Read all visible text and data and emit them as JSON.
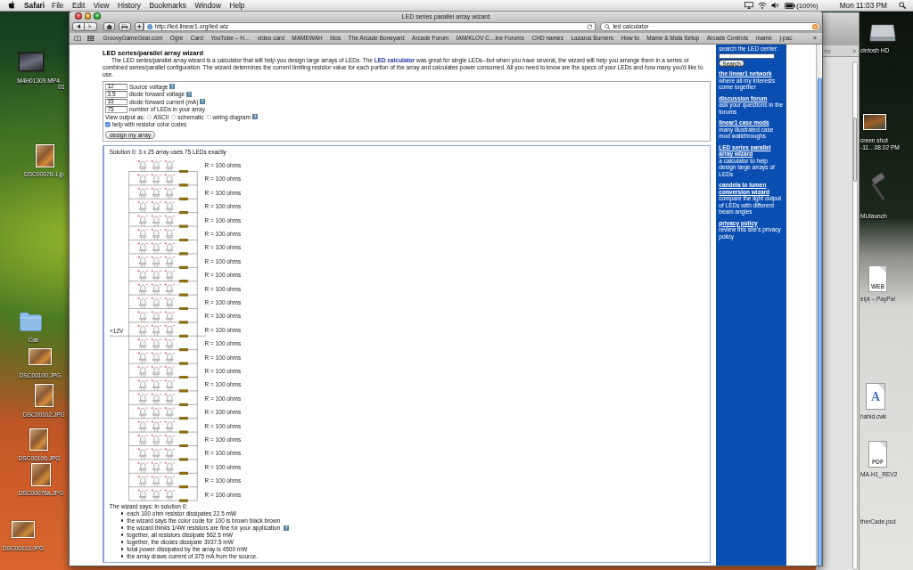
{
  "menu_bar": {
    "app": "Safari",
    "menus": [
      "File",
      "Edit",
      "View",
      "History",
      "Bookmarks",
      "Window",
      "Help"
    ],
    "battery_text": "(100%)",
    "clock": "Mon 11:03 PM"
  },
  "desktop_left": [
    {
      "kind": "video",
      "lines": [
        "M4H01309.MP4"
      ]
    },
    {
      "kind": "text",
      "lines": [
        "01"
      ]
    },
    {
      "kind": "photo",
      "lines": [
        "DSC00076-1.jp"
      ]
    },
    {
      "kind": "folder",
      "lines": [
        "Cab"
      ]
    },
    {
      "kind": "photo",
      "lines": [
        "DSC00100.JPG"
      ]
    },
    {
      "kind": "photo",
      "lines": [
        "DSC00102.JPG"
      ]
    },
    {
      "kind": "photo",
      "lines": [
        "DSC00106.JPG"
      ]
    },
    {
      "kind": "photo",
      "lines": [
        "DSC00076a.JPG"
      ]
    },
    {
      "kind": "photo",
      "lines": [
        "DSC00113.JPG"
      ]
    }
  ],
  "desktop_right": [
    {
      "kind": "drive",
      "lines": [
        "cintosh HD"
      ]
    },
    {
      "kind": "screenshot",
      "lines": [
        "creen shot",
        "-11…08.02 PM"
      ]
    },
    {
      "kind": "app",
      "lines": [
        "MUlaunch"
      ]
    },
    {
      "kind": "document",
      "badge": "WEB",
      "lines": [
        "eipt – PayPal"
      ]
    },
    {
      "kind": "letter-document",
      "badge": "A",
      "lines": [
        "hahid.cwk"
      ]
    },
    {
      "kind": "document",
      "badge": "PDF",
      "lines": [
        "MA-H1_REV2"
      ]
    },
    {
      "kind": "text",
      "lines": [
        "therCade.psd"
      ]
    }
  ],
  "background_window": {
    "label": "nc",
    "more": "»"
  },
  "browser": {
    "title": "LED series parallel array wizard",
    "back_disabled": false,
    "forward_disabled": true,
    "url": "http://led.linear1.org/led.wiz",
    "search": "led calculator",
    "bookmarks": [
      "GroovyGameGear.com",
      "Ogre",
      "Card",
      "YouTube – H…",
      "video card",
      "MAMEWAH",
      "bios",
      "The Arcade Boneyard",
      "Arcade Forum",
      "IAM/KLOV C…ine Forums",
      "CHD names",
      "Lazarus Burners",
      "How to",
      "Mame & Mala Setup",
      "Arcade Controls",
      "mame",
      "j-pac"
    ],
    "more": "»"
  },
  "page": {
    "heading": "LED series/parallel array wizard",
    "intro": {
      "before": "The LED series/parallel array wizard is a calculator that will help you design large arrays of LEDs. The ",
      "link": "LED calculator",
      "after": " was great for single LEDs--but when you have several, the wizard will help you arrange them in a series or combined series/parallel configuration. The wizard determines the current limiting resistor value for each portion of the array and calculates power consumed. All you need to know are the specs of your LEDs and how many you'd like to use."
    },
    "form": {
      "fields": [
        {
          "value": "12",
          "label": "Source voltage",
          "help": true
        },
        {
          "value": "3.5",
          "label": "diode forward voltage",
          "help": true
        },
        {
          "value": "15",
          "label": "diode forward current (mA)",
          "help": true
        },
        {
          "value": "75",
          "label": "number of LEDs in your array",
          "help": false
        }
      ],
      "output_label": "View output as:",
      "output_options": [
        {
          "label": "ASCII",
          "selected": false
        },
        {
          "label": "schematic",
          "selected": false
        },
        {
          "label": "wiring diagram",
          "selected": false
        }
      ],
      "output_help": true,
      "color_codes": {
        "label": "help with resistor color codes",
        "checked": true
      },
      "submit": "design my array"
    },
    "result": {
      "heading": "Solution 0: 3 x 25 array uses 75 LEDs exactly",
      "supply": "+12V",
      "rows": [
        {
          "parts": [
            {
              "kind": "led"
            },
            {
              "kind": "led"
            },
            {
              "kind": "led"
            },
            {
              "kind": "resistor"
            }
          ],
          "label": "R = 100 ohms"
        },
        {
          "parts": [
            {
              "kind": "led"
            },
            {
              "kind": "led"
            },
            {
              "kind": "led"
            },
            {
              "kind": "resistor"
            }
          ],
          "label": "R = 100 ohms"
        },
        {
          "parts": [
            {
              "kind": "led"
            },
            {
              "kind": "led"
            },
            {
              "kind": "led"
            },
            {
              "kind": "resistor"
            }
          ],
          "label": "R = 100 ohms"
        },
        {
          "parts": [
            {
              "kind": "led"
            },
            {
              "kind": "led"
            },
            {
              "kind": "led"
            },
            {
              "kind": "resistor"
            }
          ],
          "label": "R = 100 ohms"
        },
        {
          "parts": [
            {
              "kind": "led"
            },
            {
              "kind": "led"
            },
            {
              "kind": "led"
            },
            {
              "kind": "resistor"
            }
          ],
          "label": "R = 100 ohms"
        },
        {
          "parts": [
            {
              "kind": "led"
            },
            {
              "kind": "led"
            },
            {
              "kind": "led"
            },
            {
              "kind": "resistor"
            }
          ],
          "label": "R = 100 ohms"
        },
        {
          "parts": [
            {
              "kind": "led"
            },
            {
              "kind": "led"
            },
            {
              "kind": "led"
            },
            {
              "kind": "resistor"
            }
          ],
          "label": "R = 100 ohms"
        },
        {
          "parts": [
            {
              "kind": "led"
            },
            {
              "kind": "led"
            },
            {
              "kind": "led"
            },
            {
              "kind": "resistor"
            }
          ],
          "label": "R = 100 ohms"
        },
        {
          "parts": [
            {
              "kind": "led"
            },
            {
              "kind": "led"
            },
            {
              "kind": "led"
            },
            {
              "kind": "resistor"
            }
          ],
          "label": "R = 100 ohms"
        },
        {
          "parts": [
            {
              "kind": "led"
            },
            {
              "kind": "led"
            },
            {
              "kind": "led"
            },
            {
              "kind": "resistor"
            }
          ],
          "label": "R = 100 ohms"
        },
        {
          "parts": [
            {
              "kind": "led"
            },
            {
              "kind": "led"
            },
            {
              "kind": "led"
            },
            {
              "kind": "resistor"
            }
          ],
          "label": "R = 100 ohms"
        },
        {
          "parts": [
            {
              "kind": "led"
            },
            {
              "kind": "led"
            },
            {
              "kind": "led"
            },
            {
              "kind": "resistor"
            }
          ],
          "label": "R = 100 ohms"
        },
        {
          "parts": [
            {
              "kind": "led"
            },
            {
              "kind": "led"
            },
            {
              "kind": "led"
            },
            {
              "kind": "resistor"
            }
          ],
          "label": "R = 100 ohms"
        },
        {
          "parts": [
            {
              "kind": "led"
            },
            {
              "kind": "led"
            },
            {
              "kind": "led"
            },
            {
              "kind": "resistor"
            }
          ],
          "label": "R = 100 ohms"
        },
        {
          "parts": [
            {
              "kind": "led"
            },
            {
              "kind": "led"
            },
            {
              "kind": "led"
            },
            {
              "kind": "resistor"
            }
          ],
          "label": "R = 100 ohms"
        },
        {
          "parts": [
            {
              "kind": "led"
            },
            {
              "kind": "led"
            },
            {
              "kind": "led"
            },
            {
              "kind": "resistor"
            }
          ],
          "label": "R = 100 ohms"
        },
        {
          "parts": [
            {
              "kind": "led"
            },
            {
              "kind": "led"
            },
            {
              "kind": "led"
            },
            {
              "kind": "resistor"
            }
          ],
          "label": "R = 100 ohms"
        },
        {
          "parts": [
            {
              "kind": "led"
            },
            {
              "kind": "led"
            },
            {
              "kind": "led"
            },
            {
              "kind": "resistor"
            }
          ],
          "label": "R = 100 ohms"
        },
        {
          "parts": [
            {
              "kind": "led"
            },
            {
              "kind": "led"
            },
            {
              "kind": "led"
            },
            {
              "kind": "resistor"
            }
          ],
          "label": "R = 100 ohms"
        },
        {
          "parts": [
            {
              "kind": "led"
            },
            {
              "kind": "led"
            },
            {
              "kind": "led"
            },
            {
              "kind": "resistor"
            }
          ],
          "label": "R = 100 ohms"
        },
        {
          "parts": [
            {
              "kind": "led"
            },
            {
              "kind": "led"
            },
            {
              "kind": "led"
            },
            {
              "kind": "resistor"
            }
          ],
          "label": "R = 100 ohms"
        },
        {
          "parts": [
            {
              "kind": "led"
            },
            {
              "kind": "led"
            },
            {
              "kind": "led"
            },
            {
              "kind": "resistor"
            }
          ],
          "label": "R = 100 ohms"
        },
        {
          "parts": [
            {
              "kind": "led"
            },
            {
              "kind": "led"
            },
            {
              "kind": "led"
            },
            {
              "kind": "resistor"
            }
          ],
          "label": "R = 100 ohms"
        },
        {
          "parts": [
            {
              "kind": "led"
            },
            {
              "kind": "led"
            },
            {
              "kind": "led"
            },
            {
              "kind": "resistor"
            }
          ],
          "label": "R = 100 ohms"
        },
        {
          "parts": [
            {
              "kind": "led"
            },
            {
              "kind": "led"
            },
            {
              "kind": "led"
            },
            {
              "kind": "resistor"
            }
          ],
          "label": "R = 100 ohms"
        }
      ],
      "summary_heading": "The wizard says: In solution 0:",
      "notes": [
        {
          "text": "each 100 ohm resistor dissipates 22.5 mW",
          "help": false
        },
        {
          "text": "the wizard says the color code for 100 is brown black brown",
          "help": false
        },
        {
          "text": "the wizard thinks 1/4W resistors are fine for your application",
          "help": true
        },
        {
          "text": "together, all resistors dissipate 562.5 mW",
          "help": false
        },
        {
          "text": "together, the diodes dissipate 3937.5 mW",
          "help": false
        },
        {
          "text": "total power dissipated by the array is 4500 mW",
          "help": false
        },
        {
          "text": "the array draws current of 375 mA from the source.",
          "help": false
        }
      ]
    }
  },
  "sidebar": {
    "search_label": "search the LED center:",
    "search_button": "Search",
    "links": [
      {
        "title": "the linear1 network",
        "description": "where all my interests come together"
      },
      {
        "title": "discussion forum",
        "description": "ask your questions in the forums"
      },
      {
        "title": "linear1 case mods",
        "description": "many illustrated case mod walkthroughs"
      },
      {
        "title": "LED series parallel array wizard",
        "description": "a calculator to help design large arrays of LEDs"
      },
      {
        "title": "candela to lumen conversion wizard",
        "description": "compare the light output of LEDs with different beam angles"
      },
      {
        "title": "privacy policy",
        "description": "review this site's privacy policy"
      }
    ]
  }
}
